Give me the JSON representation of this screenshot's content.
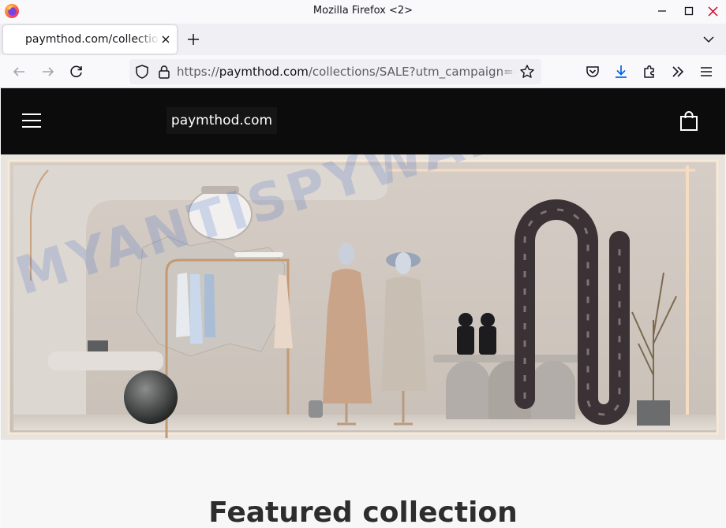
{
  "window": {
    "title": "Mozilla Firefox <2>"
  },
  "tabs": [
    {
      "title": "paymthod.com/collections/SALE",
      "active": true
    }
  ],
  "urlbar": {
    "scheme": "https://",
    "host": "paymthod.com",
    "path": "/collections/SALE?utm_campaign={{campaign.name}}"
  },
  "site": {
    "logo_text": "paymthod.com",
    "featured_heading": "Featured collection"
  },
  "watermark": "MYANTISPYWARE.COM",
  "colors": {
    "header_bg": "#0c0c0d",
    "firefox_orange": "#ff7139",
    "firefox_purple": "#9059ff",
    "download_blue": "#0061e0"
  }
}
